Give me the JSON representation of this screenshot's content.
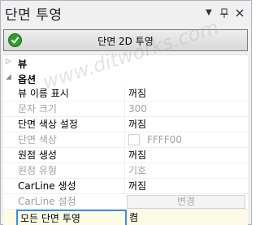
{
  "window": {
    "title": "단면 투영",
    "menu_icon": "dropdown-arrow-icon",
    "pin_icon": "pin-icon",
    "close_icon": "close-icon"
  },
  "main_button": {
    "label": "단면 2D 투영",
    "icon": "check-icon",
    "icon_color": "#2e9e2e"
  },
  "categories": {
    "view": "뷰",
    "options": "옵션"
  },
  "properties": [
    {
      "key": "뷰 이름 표시",
      "value": "꺼짐",
      "enabled": true
    },
    {
      "key": "문자 크기",
      "value": "300",
      "enabled": false
    },
    {
      "key": "단면 색상 설정",
      "value": "꺼짐",
      "enabled": true
    },
    {
      "key": "단면 색상",
      "value": "FFFF00",
      "enabled": false
    },
    {
      "key": "원점 생성",
      "value": "꺼짐",
      "enabled": true
    },
    {
      "key": "원점 유형",
      "value": "기호",
      "enabled": false
    },
    {
      "key": "CarLine 생성",
      "value": "꺼짐",
      "enabled": true
    },
    {
      "key": "CarLine 설정",
      "value": "변경",
      "enabled": false
    },
    {
      "key": "모든 단면 투영",
      "value": "켬",
      "enabled": true,
      "selected": true
    }
  ],
  "colors": {
    "selection_border": "#3a8ee6",
    "selection_bg": "#fdfbe6",
    "disabled_text": "#a0a0a0"
  },
  "watermark": "www.ditworks.com"
}
